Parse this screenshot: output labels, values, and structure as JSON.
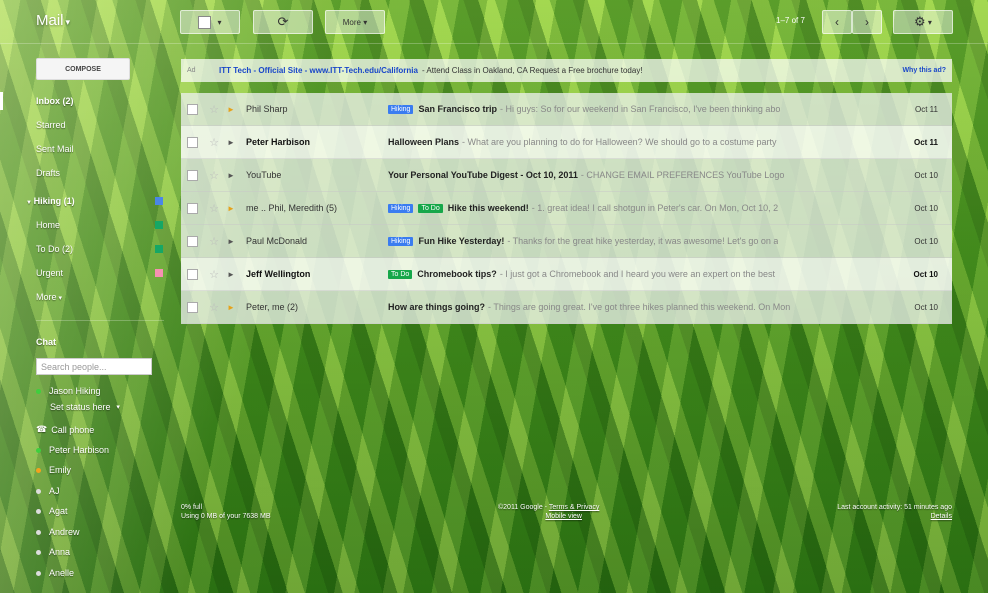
{
  "header": {
    "title": "Mail",
    "refresh_icon": "refresh-icon",
    "more_label": "More",
    "page_count": "1–7 of 7",
    "prev_icon": "chevron-left-icon",
    "next_icon": "chevron-right-icon",
    "settings_icon": "gear-icon"
  },
  "sidebar": {
    "compose_label": "COMPOSE",
    "items": [
      {
        "label": "Inbox (2)",
        "bold": true
      },
      {
        "label": "Starred"
      },
      {
        "label": "Sent Mail"
      },
      {
        "label": "Drafts"
      },
      {
        "label": "Hiking (1)",
        "bold": true,
        "color": "#4a86e8"
      },
      {
        "label": "Home",
        "color": "#16a765"
      },
      {
        "label": "To Do (2)",
        "color": "#16a765"
      },
      {
        "label": "Urgent",
        "color": "#f691b2"
      },
      {
        "label": "More"
      }
    ],
    "label_colors": {
      "blue": "#4a86e8",
      "green": "#16a765",
      "pink": "#f691b2"
    }
  },
  "chat": {
    "title": "Chat",
    "search_placeholder": "Search people...",
    "me_name": "Jason Hiking",
    "status": "Set status here",
    "call_phone": "Call phone",
    "contacts": [
      {
        "name": "Peter Harbison",
        "status": "green"
      },
      {
        "name": "Emily",
        "status": "orange"
      },
      {
        "name": "AJ",
        "status": "grey"
      },
      {
        "name": "Agat",
        "status": "grey"
      },
      {
        "name": "Andrew",
        "status": "grey"
      },
      {
        "name": "Anna",
        "status": "grey"
      },
      {
        "name": "Anelle",
        "status": "grey"
      }
    ]
  },
  "ad": {
    "tag": "Ad",
    "title": "ITT Tech - Official Site - www.ITT-Tech.edu/California",
    "text": "- Attend Class in Oakland, CA Request a Free brochure today!",
    "why": "Why this ad?"
  },
  "emails": [
    {
      "sender": "Phil Sharp",
      "important": true,
      "unread": false,
      "labels": [
        {
          "text": "Hiking",
          "color": "blue"
        }
      ],
      "subject": "San Francisco trip",
      "snippet": "- Hi guys: So for our weekend in San Francisco, I've been thinking abo",
      "date": "Oct 11"
    },
    {
      "sender": "Peter Harbison",
      "important": false,
      "unread": true,
      "labels": [],
      "subject": "Halloween Plans",
      "snippet": "- What are you planning to do for Halloween? We should go to a costume party",
      "date": "Oct 11"
    },
    {
      "sender": "YouTube",
      "important": false,
      "unread": false,
      "labels": [],
      "subject": "Your Personal YouTube Digest - Oct 10, 2011",
      "snippet": "- CHANGE EMAIL PREFERENCES YouTube Logo",
      "date": "Oct 10"
    },
    {
      "sender": "me .. Phil, Meredith (5)",
      "important": true,
      "unread": false,
      "labels": [
        {
          "text": "Hiking",
          "color": "blue"
        },
        {
          "text": "To Do",
          "color": "green"
        }
      ],
      "subject": "Hike this weekend!",
      "snippet": "- 1. great idea! I call shotgun in Peter's car. On Mon, Oct 10, 2",
      "date": "Oct 10"
    },
    {
      "sender": "Paul McDonald",
      "important": false,
      "unread": false,
      "labels": [
        {
          "text": "Hiking",
          "color": "blue"
        }
      ],
      "subject": "Fun Hike Yesterday!",
      "snippet": "- Thanks for the great hike yesterday, it was awesome! Let's go on a",
      "date": "Oct 10"
    },
    {
      "sender": "Jeff Wellington",
      "important": false,
      "unread": true,
      "labels": [
        {
          "text": "To Do",
          "color": "green"
        }
      ],
      "subject": "Chromebook tips?",
      "snippet": "- I just got a Chromebook and I heard you were an expert on the best",
      "date": "Oct 10"
    },
    {
      "sender": "Peter, me (2)",
      "important": true,
      "unread": false,
      "labels": [],
      "subject": "How are things going?",
      "snippet": "- Things are going great. I've got three hikes planned this weekend. On Mon",
      "date": "Oct 10"
    }
  ],
  "footer": {
    "usage_line1": "0% full",
    "usage_line2": "Using 0 MB of your 7638 MB",
    "copyright": "©2011 Google -",
    "terms": "Terms & Privacy",
    "mobile": "Mobile view",
    "activity": "Last account activity: 51 minutes ago",
    "details": "Details"
  }
}
